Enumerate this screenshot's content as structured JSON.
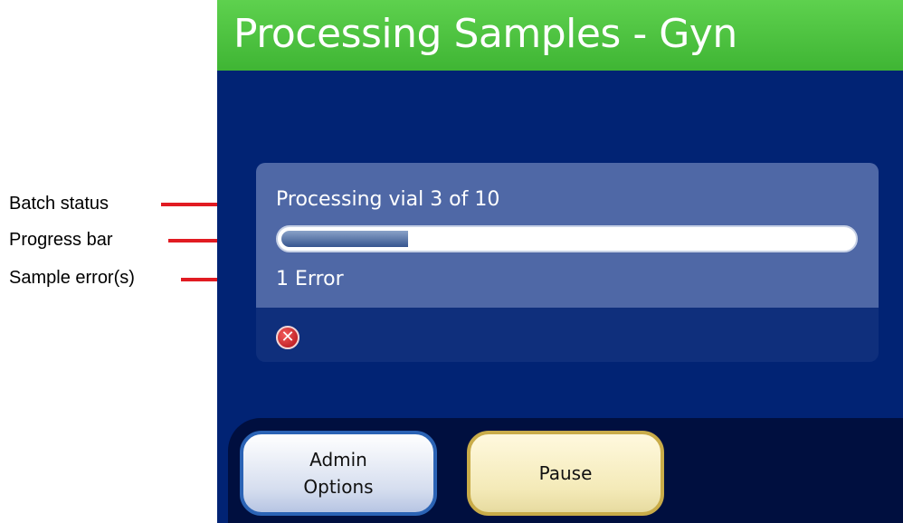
{
  "callouts": {
    "batch_status": "Batch status",
    "progress_bar": "Progress bar",
    "sample_errors": "Sample error(s)"
  },
  "header": {
    "title": "Processing Samples - Gyn"
  },
  "status": {
    "text": "Processing vial 3 of 10",
    "progress_fraction": 0.22,
    "error_text": "1 Error"
  },
  "buttons": {
    "admin_line1": "Admin",
    "admin_line2": "Options",
    "pause": "Pause"
  },
  "colors": {
    "title_bar": "#4cc440",
    "screen_bg": "#012374",
    "panel": "#4f68a6",
    "callout_line": "#e11b22",
    "admin_border": "#2b63b5",
    "pause_border": "#c9ac49"
  },
  "icons": {
    "error": "error-x-icon"
  }
}
